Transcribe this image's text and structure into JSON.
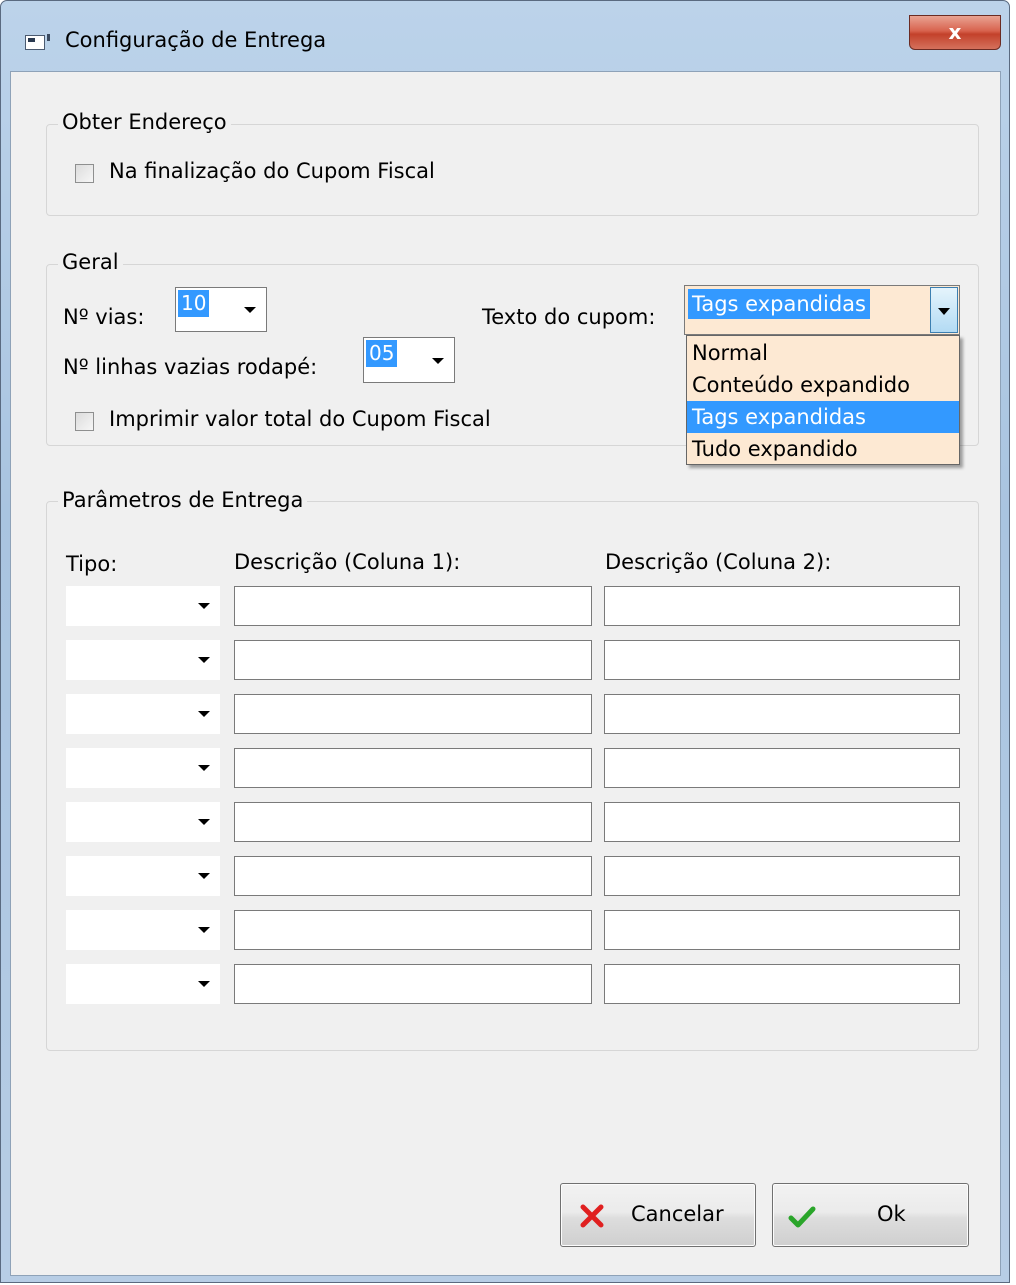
{
  "window": {
    "title": "Configuração de Entrega",
    "close_label": "x"
  },
  "obter_endereco": {
    "legend": "Obter Endereço",
    "checkbox_label": "Na finalização do Cupom Fiscal",
    "checked": false
  },
  "geral": {
    "legend": "Geral",
    "vias_label": "Nº vias:",
    "vias_value": "10",
    "linhas_label": "Nº linhas vazias rodapé:",
    "linhas_value": "05",
    "imprimir_label": "Imprimir valor total do Cupom Fiscal",
    "imprimir_checked": false,
    "texto_label": "Texto do cupom:",
    "texto_value": "Tags expandidas",
    "texto_options": [
      "Normal",
      "Conteúdo expandido",
      "Tags expandidas",
      "Tudo expandido"
    ],
    "texto_selected_index": 2
  },
  "parametros": {
    "legend": "Parâmetros de Entrega",
    "col_tipo": "Tipo:",
    "col_desc1": "Descrição (Coluna 1):",
    "col_desc2": "Descrição (Coluna 2):",
    "rows": [
      {
        "tipo": "",
        "desc1": "",
        "desc2": ""
      },
      {
        "tipo": "",
        "desc1": "",
        "desc2": ""
      },
      {
        "tipo": "",
        "desc1": "",
        "desc2": ""
      },
      {
        "tipo": "",
        "desc1": "",
        "desc2": ""
      },
      {
        "tipo": "",
        "desc1": "",
        "desc2": ""
      },
      {
        "tipo": "",
        "desc1": "",
        "desc2": ""
      },
      {
        "tipo": "",
        "desc1": "",
        "desc2": ""
      },
      {
        "tipo": "",
        "desc1": "",
        "desc2": ""
      }
    ]
  },
  "buttons": {
    "cancel_label": "Cancelar",
    "ok_label": "Ok"
  },
  "colors": {
    "selection": "#3399ff",
    "combo_background": "#fde9d3",
    "cancel_icon": "#e02020",
    "ok_icon": "#2aa52a"
  },
  "icons": {
    "window": "app-window-icon",
    "close": "close-icon",
    "cancel": "x-mark-icon",
    "ok": "checkmark-icon",
    "dropdown": "chevron-down-icon"
  }
}
